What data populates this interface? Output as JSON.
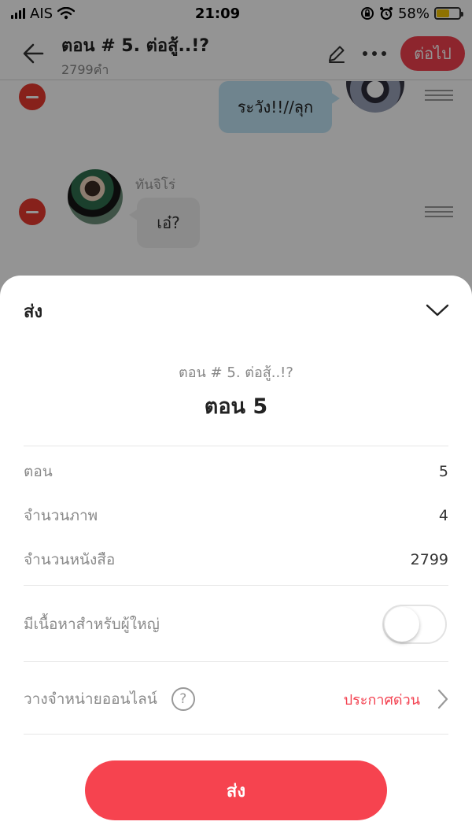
{
  "status_bar": {
    "carrier": "AIS",
    "time": "21:09",
    "battery": "58%"
  },
  "header": {
    "title": "ตอน # 5. ต่อสู้..!?",
    "subtitle": "2799คำ",
    "next_label": "ต่อไป"
  },
  "chat": {
    "messages": [
      {
        "side": "right",
        "text": "ระวัง!!//ลุก"
      },
      {
        "side": "left",
        "speaker": "ทันจิโร่",
        "text": "เอ๋?"
      }
    ]
  },
  "sheet": {
    "title": "ส่ง",
    "episode_subtitle": "ตอน # 5. ต่อสู้..!?",
    "episode_title": "ตอน 5",
    "rows": [
      {
        "label": "ตอน",
        "value": "5"
      },
      {
        "label": "จำนวนภาพ",
        "value": "4"
      },
      {
        "label": "จำนวนหนังสือ",
        "value": "2799"
      }
    ],
    "adult_label": "มีเนื้อหาสำหรับผู้ใหญ่",
    "adult_enabled": false,
    "online_label": "วางจำหน่ายออนไลน์",
    "help_symbol": "?",
    "online_value": "ประกาศด่วน",
    "send_label": "ส่ง"
  },
  "colors": {
    "accent": "#f3404f",
    "delete": "#e8392f",
    "bubble_right": "#bfe3f5",
    "bubble_left": "#f0f0f0"
  }
}
